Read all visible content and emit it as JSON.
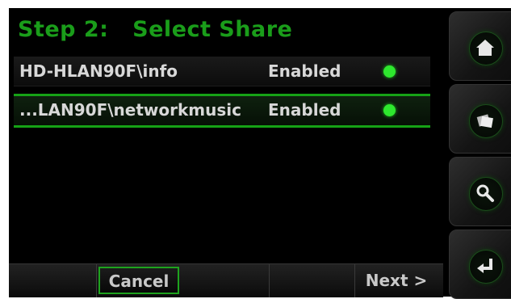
{
  "header": {
    "title": "Step 2:   Select Share"
  },
  "shares": [
    {
      "name": "HD-HLAN90F\\info",
      "status": "Enabled",
      "status_color": "#2ee82e"
    },
    {
      "name": "...LAN90F\\networkmusic",
      "status": "Enabled",
      "status_color": "#2ee82e"
    }
  ],
  "selected_index": 1,
  "bottom_bar": {
    "cancel_label": "Cancel",
    "next_label": "Next >"
  },
  "side_buttons": [
    {
      "name": "home-button",
      "icon": "home-icon"
    },
    {
      "name": "media-button",
      "icon": "photos-icon"
    },
    {
      "name": "search-button",
      "icon": "magnifier-icon"
    },
    {
      "name": "enter-button",
      "icon": "enter-return-icon"
    }
  ],
  "colors": {
    "accent_green": "#16a216",
    "title_green": "#1a9d1a",
    "text": "#d8d8d8"
  }
}
